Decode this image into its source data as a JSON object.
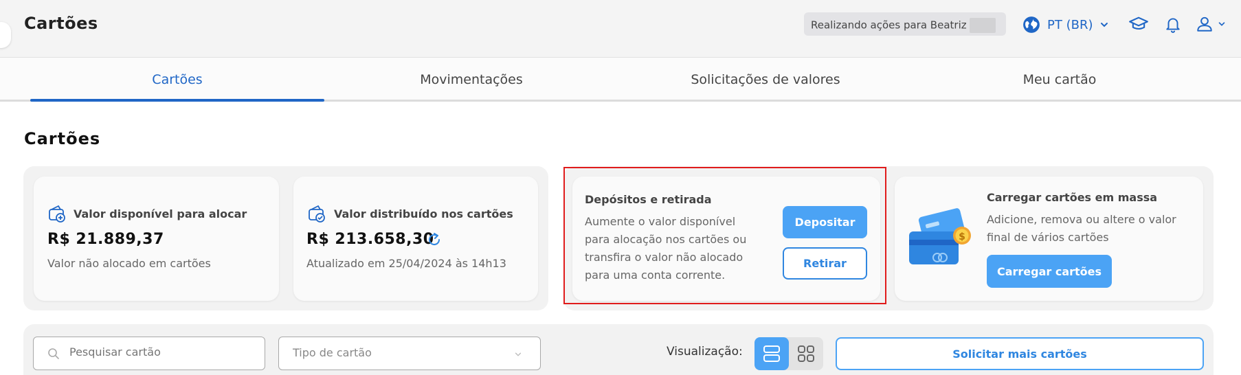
{
  "header": {
    "title": "Cartões",
    "impersonation_text": "Realizando ações para Beatriz",
    "language": "PT (BR)"
  },
  "tabs": [
    {
      "label": "Cartões",
      "active": true
    },
    {
      "label": "Movimentações",
      "active": false
    },
    {
      "label": "Solicitações de valores",
      "active": false
    },
    {
      "label": "Meu cartão",
      "active": false
    }
  ],
  "section_title": "Cartões",
  "balance": {
    "available": {
      "label": "Valor disponível para alocar",
      "value": "R$ 21.889,37",
      "note": "Valor não alocado em cartões"
    },
    "distributed": {
      "label": "Valor distribuído nos cartões",
      "value": "R$ 213.658,30",
      "note": "Atualizado em 25/04/2024 às 14h13"
    }
  },
  "deposits": {
    "title": "Depósitos e retirada",
    "description": [
      "Aumente o valor disponível",
      "para alocação nos cartões ou",
      "transfira o valor não alocado",
      "para uma conta corrente."
    ],
    "deposit_label": "Depositar",
    "withdraw_label": "Retirar"
  },
  "bulk": {
    "title": "Carregar cartões em massa",
    "description": [
      "Adicione, remova ou altere o valor",
      "final de vários cartões"
    ],
    "button_label": "Carregar cartões"
  },
  "filters": {
    "search_placeholder": "Pesquisar cartão",
    "card_type_placeholder": "Tipo de cartão",
    "view_label": "Visualização:",
    "request_label": "Solicitar mais cartões"
  },
  "colors": {
    "accent": "#1f66c6",
    "button": "#4ba3f5",
    "highlight": "#e01b1b"
  }
}
